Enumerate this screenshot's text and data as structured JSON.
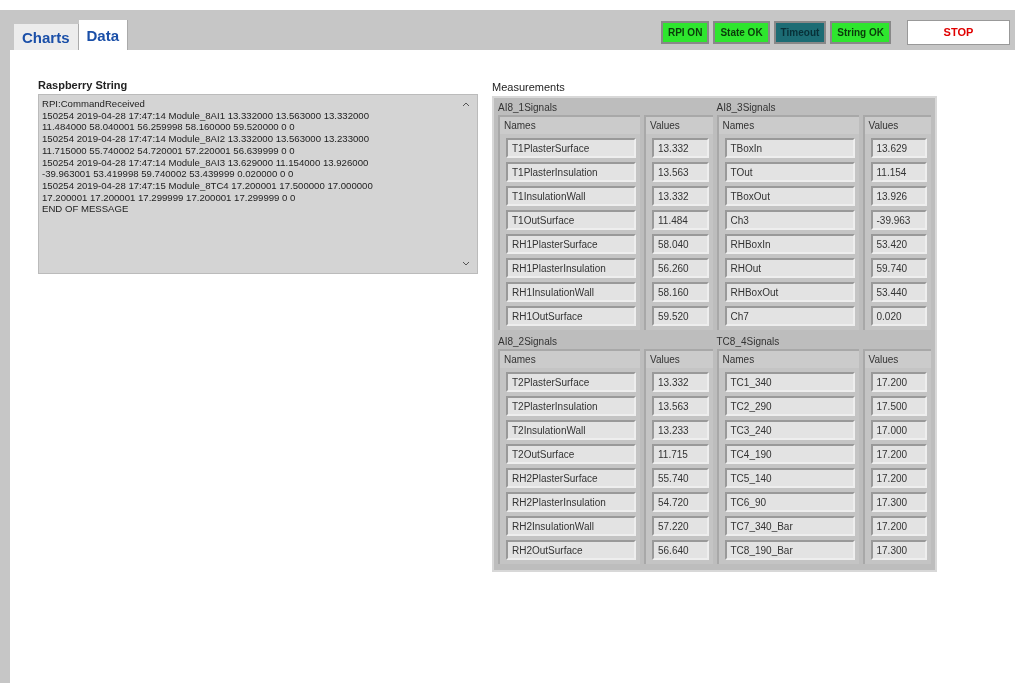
{
  "tabs": [
    {
      "label": "Charts",
      "selected": false
    },
    {
      "label": "Data",
      "selected": true
    }
  ],
  "indicators": [
    {
      "label": "RPI ON",
      "on": true
    },
    {
      "label": "State OK",
      "on": true
    },
    {
      "label": "Timeout",
      "on": false
    },
    {
      "label": "String OK",
      "on": true
    }
  ],
  "stop_button": {
    "label": "STOP"
  },
  "raspberry_string": {
    "label": "Raspberry String",
    "lines": [
      "RPI:CommandReceived",
      "150254 2019-04-28 17:47:14 Module_8AI1 13.332000 13.563000 13.332000",
      "11.484000 58.040001 56.259998 58.160000 59.520000 0 0",
      "150254 2019-04-28 17:47:14 Module_8AI2 13.332000 13.563000 13.233000",
      "11.715000 55.740002 54.720001 57.220001 56.639999 0 0",
      "150254 2019-04-28 17:47:14 Module_8AI3 13.629000 11.154000 13.926000",
      "-39.963001 53.419998 59.740002 53.439999 0.020000 0 0",
      "150254 2019-04-28 17:47:15 Module_8TC4 17.200001 17.500000 17.000000",
      "17.200001 17.200001 17.299999 17.200001 17.299999 0 0",
      "END OF MESSAGE"
    ]
  },
  "measurements": {
    "label": "Measurements",
    "clusters": [
      {
        "title": "AI8_1Signals",
        "names_header": "Names",
        "values_header": "Values",
        "rows": [
          {
            "name": "T1PlasterSurface",
            "value": "13.332"
          },
          {
            "name": "T1PlasterInsulation",
            "value": "13.563"
          },
          {
            "name": "T1InsulationWall",
            "value": "13.332"
          },
          {
            "name": "T1OutSurface",
            "value": "11.484"
          },
          {
            "name": "RH1PlasterSurface",
            "value": "58.040"
          },
          {
            "name": "RH1PlasterInsulation",
            "value": "56.260"
          },
          {
            "name": "RH1InsulationWall",
            "value": "58.160"
          },
          {
            "name": "RH1OutSurface",
            "value": "59.520"
          }
        ]
      },
      {
        "title": "AI8_3Signals",
        "names_header": "Names",
        "values_header": "Values",
        "rows": [
          {
            "name": "TBoxIn",
            "value": "13.629"
          },
          {
            "name": "TOut",
            "value": "11.154"
          },
          {
            "name": "TBoxOut",
            "value": "13.926"
          },
          {
            "name": "Ch3",
            "value": "-39.963"
          },
          {
            "name": "RHBoxIn",
            "value": "53.420"
          },
          {
            "name": "RHOut",
            "value": "59.740"
          },
          {
            "name": "RHBoxOut",
            "value": "53.440"
          },
          {
            "name": "Ch7",
            "value": "0.020"
          }
        ]
      },
      {
        "title": "AI8_2Signals",
        "names_header": "Names",
        "values_header": "Values",
        "rows": [
          {
            "name": "T2PlasterSurface",
            "value": "13.332"
          },
          {
            "name": "T2PlasterInsulation",
            "value": "13.563"
          },
          {
            "name": "T2InsulationWall",
            "value": "13.233"
          },
          {
            "name": "T2OutSurface",
            "value": "11.715"
          },
          {
            "name": "RH2PlasterSurface",
            "value": "55.740"
          },
          {
            "name": "RH2PlasterInsulation",
            "value": "54.720"
          },
          {
            "name": "RH2InsulationWall",
            "value": "57.220"
          },
          {
            "name": "RH2OutSurface",
            "value": "56.640"
          }
        ]
      },
      {
        "title": "TC8_4Signals",
        "names_header": "Names",
        "values_header": "Values",
        "rows": [
          {
            "name": "TC1_340",
            "value": "17.200"
          },
          {
            "name": "TC2_290",
            "value": "17.500"
          },
          {
            "name": "TC3_240",
            "value": "17.000"
          },
          {
            "name": "TC4_190",
            "value": "17.200"
          },
          {
            "name": "TC5_140",
            "value": "17.200"
          },
          {
            "name": "TC6_90",
            "value": "17.300"
          },
          {
            "name": "TC7_340_Bar",
            "value": "17.200"
          },
          {
            "name": "TC8_190_Bar",
            "value": "17.300"
          }
        ]
      }
    ]
  }
}
